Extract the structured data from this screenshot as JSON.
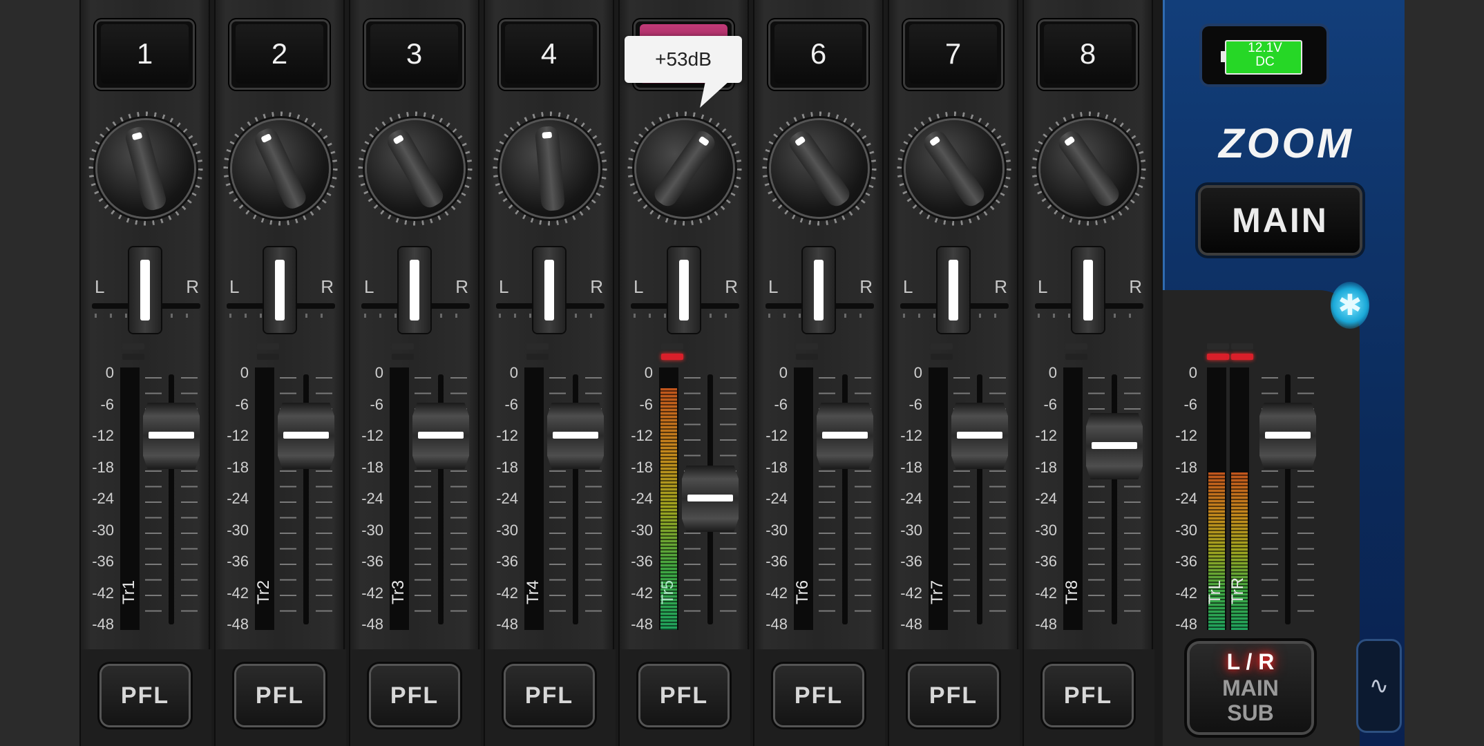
{
  "channels": [
    {
      "name": "1",
      "track": "Tr1",
      "knob_angle": -15,
      "meter": 0,
      "fader": "-12"
    },
    {
      "name": "2",
      "track": "Tr2",
      "knob_angle": -25,
      "meter": 0,
      "fader": "-12"
    },
    {
      "name": "3",
      "track": "Tr3",
      "knob_angle": -30,
      "meter": 0,
      "fader": "-12"
    },
    {
      "name": "4",
      "track": "Tr4",
      "knob_angle": -5,
      "meter": 0,
      "fader": "-12"
    },
    {
      "name": "",
      "track": "Tr5",
      "knob_angle": 35,
      "meter": 0.92,
      "fader": "-24",
      "active": true,
      "tooltip": "+53dB"
    },
    {
      "name": "6",
      "track": "Tr6",
      "knob_angle": -35,
      "meter": 0,
      "fader": "-12"
    },
    {
      "name": "7",
      "track": "Tr7",
      "knob_angle": -35,
      "meter": 0,
      "fader": "-12"
    },
    {
      "name": "8",
      "track": "Tr8",
      "knob_angle": -35,
      "meter": 0,
      "fader": "-14"
    }
  ],
  "pan": {
    "left": "L",
    "right": "R"
  },
  "scale": [
    "0",
    "-6",
    "-12",
    "-18",
    "-24",
    "-30",
    "-36",
    "-42",
    "-48"
  ],
  "pfl_label": "PFL",
  "master": {
    "battery_line1": "12.1V",
    "battery_line2": "DC",
    "logo": "ZOOM",
    "main_label": "MAIN",
    "tracks": [
      "TrL",
      "TrR"
    ],
    "meter": 0.6,
    "fader": "-12",
    "lr_line1": "L / R",
    "lr_line2": "MAIN",
    "lr_line3": "SUB",
    "bluetooth_icon": "bluetooth-icon",
    "wave_icon": "waveform-icon"
  },
  "colors": {
    "active_name": "#c23a78",
    "clip_red": "#d91f2a",
    "meter_green": "#20a25c",
    "side_blue": "#123e7a"
  }
}
